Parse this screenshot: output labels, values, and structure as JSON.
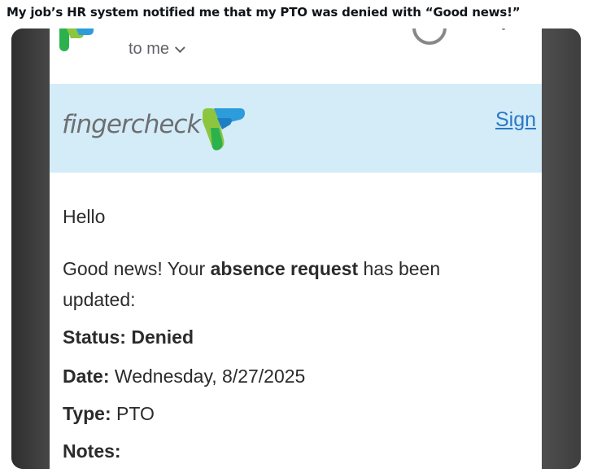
{
  "caption": "My job’s HR system notified me that my PTO was denied with “Good news!”",
  "email": {
    "recipient": "to me",
    "brand": {
      "name": "fingercheck",
      "sign_link": "Sign"
    },
    "greeting": "Hello",
    "intro_prefix": "Good news! Your ",
    "intro_bold": "absence request",
    "intro_suffix": " has been",
    "intro_line2": "updated:",
    "status": {
      "label": "Status:",
      "value": "Denied"
    },
    "date": {
      "label": "Date:",
      "value": "Wednesday, 8/27/2025"
    },
    "type": {
      "label": "Type:",
      "value": "PTO"
    },
    "notes": {
      "label": "Notes:"
    }
  },
  "colors": {
    "banner_bg": "#d4ecf8",
    "logo_green_light": "#8cc63f",
    "logo_green_dark": "#2bb24c",
    "logo_blue": "#2d9cdb",
    "link": "#2a78c5"
  },
  "icons": [
    "fingercheck-logo-icon",
    "chevron-down-icon"
  ]
}
